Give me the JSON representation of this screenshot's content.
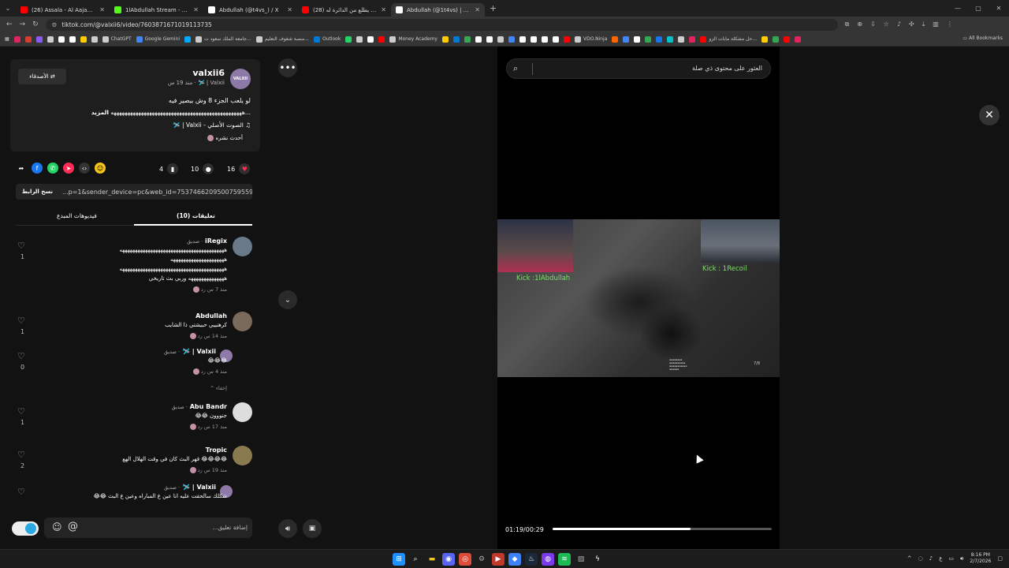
{
  "browser": {
    "tabs": [
      {
        "title": "(26) Assala - Al Aajab Fi Al Ha...",
        "color": "#ff0000",
        "active": false
      },
      {
        "title": "1lAbdullah Stream - Watch Liv...",
        "color": "#53fc18",
        "active": false
      },
      {
        "title": "Abdullah (@t4vs_) / X",
        "color": "#ffffff",
        "active": false
      },
      {
        "title": "(28) اخر واحد يطلع من الدائرة له...",
        "color": "#ff0000",
        "active": false
      },
      {
        "title": "Abdullah (@1t4vs) | TikTok",
        "color": "#ffffff",
        "active": true
      }
    ],
    "url": "tiktok.com/@valxii6/video/7603871671019113735",
    "bookmarks": [
      {
        "label": "",
        "color": "#e0245e"
      },
      {
        "label": "",
        "color": "#d23f31"
      },
      {
        "label": "",
        "color": "#8a5cf6"
      },
      {
        "label": "",
        "color": "#cccccc"
      },
      {
        "label": "",
        "color": "#ffffff"
      },
      {
        "label": "",
        "color": "#ffffff"
      },
      {
        "label": "",
        "color": "#ffcc00"
      },
      {
        "label": "",
        "color": "#cccccc"
      },
      {
        "label": "ChatGPT",
        "color": "#cccccc"
      },
      {
        "label": "Google Gemini",
        "color": "#4285f4"
      },
      {
        "label": "",
        "color": "#00aaff"
      },
      {
        "label": "جامعة الملك سعود ت...",
        "color": "#cccccc"
      },
      {
        "label": "منصة شغوف التعليم...",
        "color": "#cccccc"
      },
      {
        "label": "Outlook",
        "color": "#0078d4"
      },
      {
        "label": "",
        "color": "#25d366"
      },
      {
        "label": "",
        "color": "#cccccc"
      },
      {
        "label": "",
        "color": "#ffffff"
      },
      {
        "label": "",
        "color": "#ff0000"
      },
      {
        "label": "Money Academy",
        "color": "#cccccc"
      },
      {
        "label": "",
        "color": "#ffcc00"
      },
      {
        "label": "",
        "color": "#0078d4"
      },
      {
        "label": "",
        "color": "#34a853"
      },
      {
        "label": "",
        "color": "#ffffff"
      },
      {
        "label": "",
        "color": "#ffffff"
      },
      {
        "label": "",
        "color": "#cccccc"
      },
      {
        "label": "",
        "color": "#4285f4"
      },
      {
        "label": "",
        "color": "#ffffff"
      },
      {
        "label": "",
        "color": "#ffffff"
      },
      {
        "label": "",
        "color": "#ffffff"
      },
      {
        "label": "",
        "color": "#ffffff"
      },
      {
        "label": "",
        "color": "#ff0000"
      },
      {
        "label": "VDO.Ninja",
        "color": "#cccccc"
      },
      {
        "label": "",
        "color": "#ff6600"
      },
      {
        "label": "",
        "color": "#4285f4"
      },
      {
        "label": "",
        "color": "#ffffff"
      },
      {
        "label": "",
        "color": "#34a853"
      },
      {
        "label": "",
        "color": "#1a73e8"
      },
      {
        "label": "",
        "color": "#00c4cc"
      },
      {
        "label": "",
        "color": "#cccccc"
      },
      {
        "label": "",
        "color": "#e0245e"
      },
      {
        "label": "حل مشكلة مابات الزو...",
        "color": "#ff0000"
      },
      {
        "label": "",
        "color": "#ffcc00"
      },
      {
        "label": "",
        "color": "#34a853"
      },
      {
        "label": "",
        "color": "#ff0000"
      },
      {
        "label": "",
        "color": "#e0245e"
      }
    ],
    "all_bookmarks": "All Bookmarks"
  },
  "post": {
    "username": "valxii6",
    "avatar_text": "VALXII",
    "subline": "Valxii | 🛩️ · منذ 19 س",
    "friends_button": "⇄ الأصدقاء",
    "caption_line1": "لو يلعب الجزء 8 وش بيصير فيه",
    "caption_line2_more": "المزيد",
    "caption_line2": "...ههههههههههههههههههههههههههههههههههههههههههههههههه",
    "sound": "♫ الصوت الأصلي - Valxii | 🛩️",
    "recent": "أحدث نشره",
    "likes": "16",
    "comments": "10",
    "saves": "4",
    "copy_url": "...p=1&sender_device=pc&web_id=7537466209500759559",
    "copy_button": "نسخ الرابط",
    "tab_comments": "تعليقات (10)",
    "tab_creator": "فيديوهات المبدع"
  },
  "comments": [
    {
      "name": "iRegix",
      "tag": "· صديق",
      "lines": [
        "هههههههههههههههههههههههههههههههههههههههههه",
        "هههههههههههههههههههههه",
        "هههههههههههههههههههههههههههههههههههههههههه",
        "ههههههههههههههه وربي بث تاريخي"
      ],
      "meta": "منذ 7 س    رد",
      "likes": "1",
      "avatar_color": "#6a7a8a"
    },
    {
      "name": "Abdullah",
      "tag": "",
      "lines": [
        "كرهنييي حبيشتي ذا الشايب"
      ],
      "meta": "منذ 14 س    رد",
      "likes": "1",
      "avatar_color": "#7a6a5a"
    },
    {
      "name": "Valxii | 🛩️",
      "tag": "· صديق",
      "lines": [
        "😂😂😂"
      ],
      "meta": "منذ 4 س    رد",
      "likes": "0",
      "avatar_color": "#8e7aa8"
    },
    {
      "name": "Abu Bandr",
      "tag": "· صديق",
      "lines": [
        "جنووون 😂😂"
      ],
      "meta": "منذ 17 س    رد",
      "likes": "1",
      "avatar_color": "#ddd"
    },
    {
      "name": "Tropic",
      "tag": "",
      "lines": [
        "😂😂😂😂 قهر البث كان في وقت الهلال الهع"
      ],
      "meta": "منذ 19 س    رد",
      "likes": "2",
      "avatar_color": "#8a7a50"
    },
    {
      "name": "Valxii | 🛩️",
      "tag": "· صديق",
      "lines": [
        "شكلك سالحقت عليه انا عين ع المباراه وعين ع البث 😂😂"
      ],
      "meta": "",
      "likes": "",
      "avatar_color": "#8e7aa8"
    }
  ],
  "hide_replies": "إخفاء ^",
  "comment_placeholder": "إضافة تعليق...",
  "video": {
    "search_placeholder": "العثور على محتوى ذي صلة",
    "cam1_label": "Kick :1lAbdullah",
    "cam2_label": "Kick : 1Recoil",
    "pager": "7/8",
    "time": "01:19/00:29",
    "progress": 0.63
  },
  "taskbar": {
    "time": "8:16 PM",
    "date": "2/7/2026",
    "lang": "ع"
  }
}
